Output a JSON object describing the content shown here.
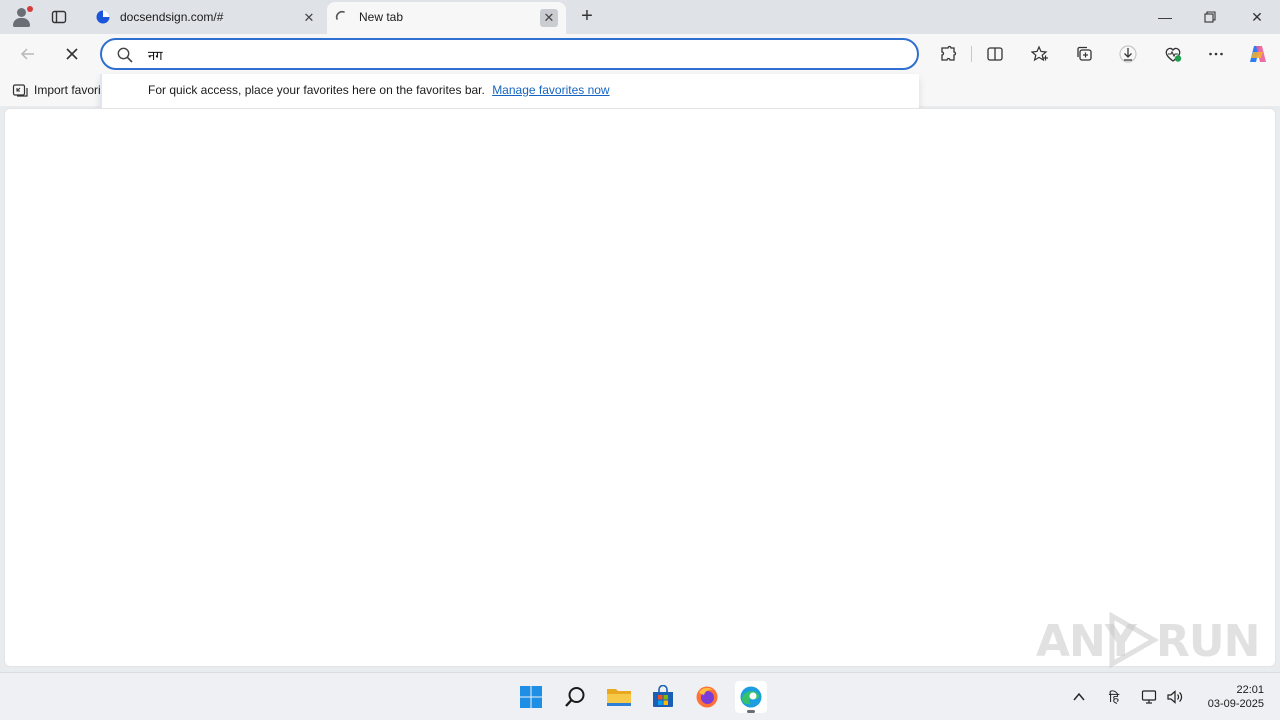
{
  "tabs": [
    {
      "title": "docsendsign.com/#",
      "favicon": "edge-page-icon"
    },
    {
      "title": "New tab",
      "favicon": "loading-spinner-icon",
      "active": true
    }
  ],
  "address_bar": {
    "value": "नग",
    "placeholder": ""
  },
  "favorites_bar": {
    "import_label": "Import favorites"
  },
  "dropdown": {
    "message": "For quick access, place your favorites here on the favorites bar.",
    "link_label": "Manage favorites now"
  },
  "watermark": {
    "part1": "ANY",
    "part2": "RUN"
  },
  "taskbar": {
    "apps": [
      "windows-start-icon",
      "search-icon",
      "file-explorer-icon",
      "microsoft-store-icon",
      "firefox-icon",
      "edge-icon"
    ],
    "tray": {
      "language": "हि"
    },
    "clock": {
      "time": "22:01",
      "date": "03-09-2025"
    }
  },
  "colors": {
    "accent": "#2f6fd0",
    "link": "#1565c0",
    "tabstrip": "#dfe3e8",
    "toolbar": "#f7f7f7"
  }
}
